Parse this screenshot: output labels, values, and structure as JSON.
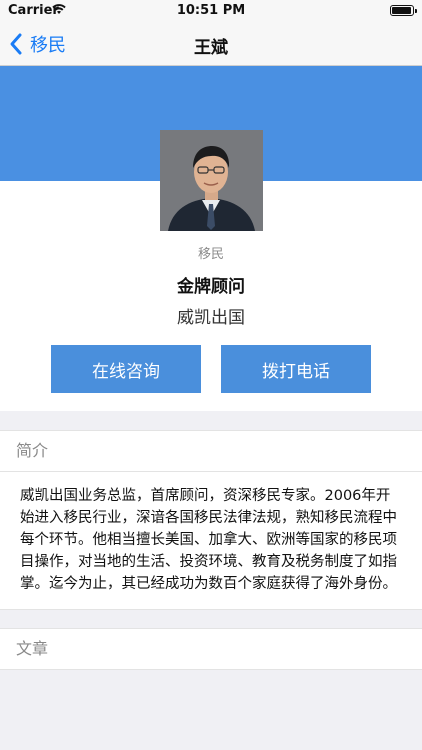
{
  "status_bar": {
    "carrier": "Carrier",
    "time": "10:51 PM"
  },
  "nav": {
    "back_label": "移民",
    "title": "王斌"
  },
  "profile": {
    "category": "移民",
    "title": "金牌顾问",
    "company": "威凯出国"
  },
  "actions": {
    "consult_label": "在线咨询",
    "call_label": "拨打电话"
  },
  "intro": {
    "header": "简介",
    "text": "威凯出国业务总监，首席顾问，资深移民专家。2006年开始进入移民行业，深谙各国移民法律法规，熟知移民流程中每个环节。他相当擅长美国、加拿大、欧洲等国家的移民项目操作，对当地的生活、投资环境、教育及税务制度了如指掌。迄今为止，其已经成功为数百个家庭获得了海外身份。"
  },
  "articles": {
    "header": "文章"
  },
  "colors": {
    "accent": "#1a7cf5",
    "banner": "#4a90e2",
    "button": "#4a8fdc"
  }
}
